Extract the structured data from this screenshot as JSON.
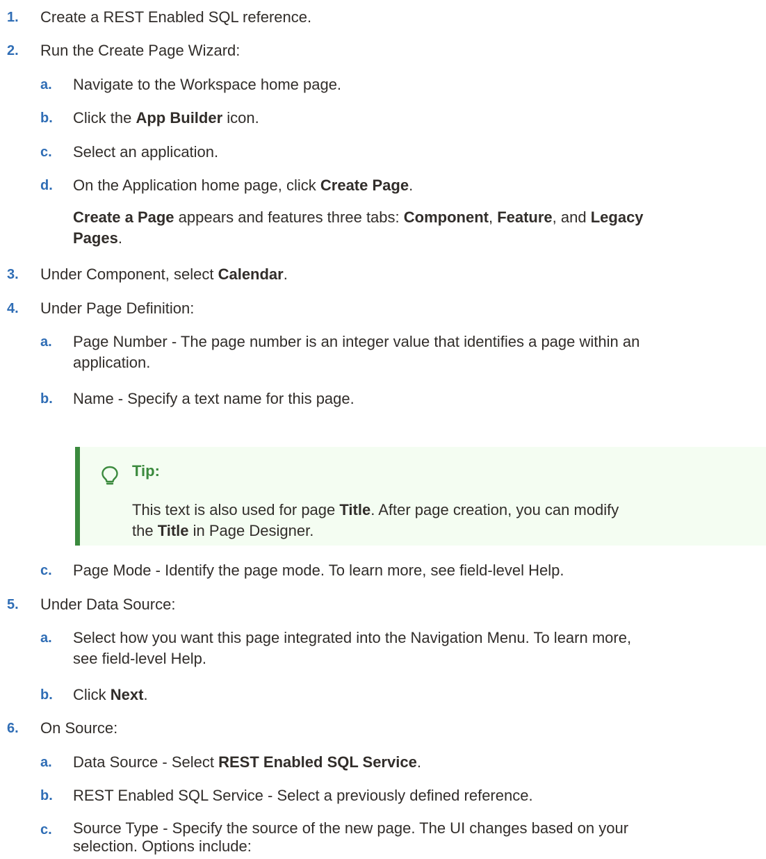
{
  "steps": {
    "s1": {
      "num": "1.",
      "text": "Create a REST Enabled SQL reference."
    },
    "s2": {
      "num": "2.",
      "text": "Run the Create Page Wizard:",
      "a": {
        "num": "a.",
        "text": "Navigate to the Workspace home page."
      },
      "b": {
        "num": "b.",
        "pre": "Click the ",
        "bold": "App Builder",
        "post": " icon."
      },
      "c": {
        "num": "c.",
        "text": "Select an application."
      },
      "d": {
        "num": "d.",
        "pre": "On the Application home page, click ",
        "bold": "Create Page",
        "post": "."
      },
      "note": {
        "b1": "Create a Page",
        "t1": " appears and features three tabs: ",
        "b2": "Component",
        "t2": ", ",
        "b3": "Feature",
        "t3": ", and ",
        "b4": "Legacy",
        "b5": "Pages",
        "t4": "."
      }
    },
    "s3": {
      "num": "3.",
      "pre": "Under Component, select ",
      "bold": "Calendar",
      "post": "."
    },
    "s4": {
      "num": "4.",
      "text": "Under Page Definition:",
      "a": {
        "num": "a.",
        "line1": "Page Number - The page number is an integer value that identifies a page within an",
        "line2": "application."
      },
      "b": {
        "num": "b.",
        "text": "Name - Specify a text name for this page."
      },
      "tip": {
        "title": "Tip:",
        "t1": "This text is also used for page ",
        "b1": "Title",
        "t2": ". After page creation, you can modify",
        "t3": "the ",
        "b2": "Title",
        "t4": " in Page Designer."
      },
      "c": {
        "num": "c.",
        "text": "Page Mode - Identify the page mode. To learn more, see field-level Help."
      }
    },
    "s5": {
      "num": "5.",
      "text": "Under Data Source:",
      "a": {
        "num": "a.",
        "line1": "Select how you want this page integrated into the Navigation Menu. To learn more,",
        "line2": "see field-level Help."
      },
      "b": {
        "num": "b.",
        "pre": "Click ",
        "bold": "Next",
        "post": "."
      }
    },
    "s6": {
      "num": "6.",
      "text": "On Source:",
      "a": {
        "num": "a.",
        "pre": "Data Source - Select ",
        "bold": "REST Enabled SQL Service",
        "post": "."
      },
      "b": {
        "num": "b.",
        "text": "REST Enabled SQL Service - Select a previously defined reference."
      },
      "c": {
        "num": "c.",
        "line1": "Source Type - Specify the source of the new page. The UI changes based on your",
        "line2": "selection. Options include:"
      }
    }
  },
  "colors": {
    "step_number": "#2f6db5",
    "tip_accent": "#3b8a3e",
    "tip_background": "#f4fdf2",
    "text": "#312d2a"
  }
}
